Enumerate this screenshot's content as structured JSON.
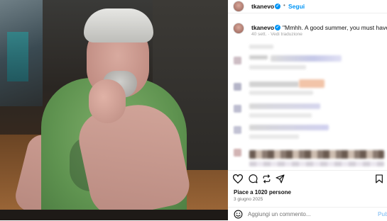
{
  "post": {
    "username": "tkanevo",
    "follow_label": "Segui",
    "caption_text": "\"Mmhh. A good summer, you must have. Yes.\"",
    "caption_meta": "40 sett. · Vedi traduzione",
    "likes": "Piace a 1020 persone",
    "date": "3 giugno 2025",
    "comment_placeholder": "Aggiungi un commento...",
    "post_label": "Pub"
  },
  "icons": {
    "like": "heart-icon",
    "comment": "comment-icon",
    "share": "repost-icon",
    "send": "send-icon",
    "save": "bookmark-icon",
    "emoji": "emoji-icon",
    "verified": "verified-badge-icon"
  },
  "colors": {
    "accent": "#0095f6",
    "verified": "#0095f6"
  }
}
